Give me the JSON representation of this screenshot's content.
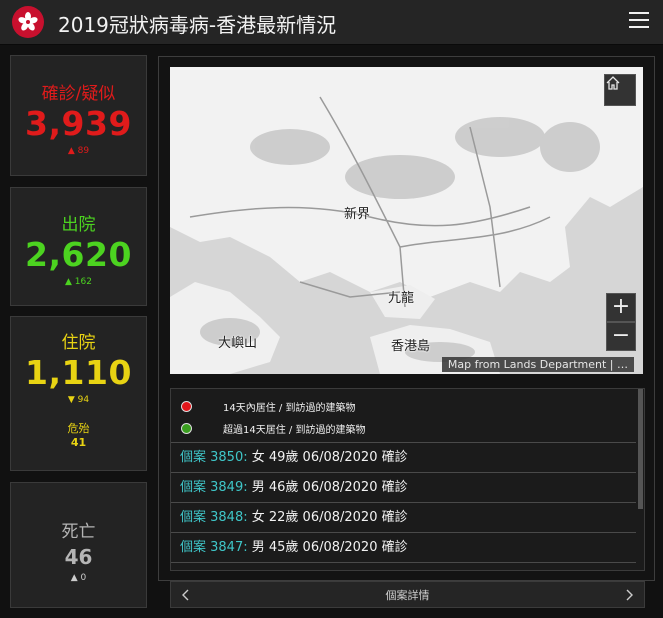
{
  "header": {
    "title": "2019冠狀病毒病-香港最新情況"
  },
  "stats": {
    "confirmed": {
      "label": "確診/疑似",
      "value": "3,939",
      "delta": "▲ 89"
    },
    "discharged": {
      "label": "出院",
      "value": "2,620",
      "delta": "▲ 162"
    },
    "hospitalised": {
      "label": "住院",
      "value": "1,110",
      "delta": "▼ 94",
      "critical_label": "危殆",
      "critical_value": "41"
    },
    "deaths": {
      "label": "死亡",
      "value": "46",
      "delta": "▲ 0"
    }
  },
  "map": {
    "labels": {
      "new_territories": "新界",
      "kowloon": "九龍",
      "lantau": "大嶼山",
      "hk_island": "香港島"
    },
    "zoom_in": "+",
    "zoom_out": "−",
    "attribution": "Map from Lands Department | …"
  },
  "legend": [
    {
      "color": "#e3161b",
      "text": "14天內居住 / 到訪過的建築物"
    },
    {
      "color": "#3a9e1f",
      "text": "超過14天居住 / 到訪過的建築物"
    }
  ],
  "cases": [
    {
      "id": "個案 3850:",
      "detail": " 女  49歲  06/08/2020 確診"
    },
    {
      "id": "個案 3849:",
      "detail": " 男  46歲  06/08/2020 確診"
    },
    {
      "id": "個案 3848:",
      "detail": " 女  22歲  06/08/2020 確診"
    },
    {
      "id": "個案 3847:",
      "detail": " 男  45歲  06/08/2020 確診"
    }
  ],
  "footer": {
    "nav_label": "個案詳情"
  },
  "colors": {
    "confirmed": "#e01b1b",
    "discharged": "#4cd320",
    "hospitalised": "#e8d313",
    "deaths": "#b5b5b5",
    "case_id": "#3fc6c8"
  }
}
